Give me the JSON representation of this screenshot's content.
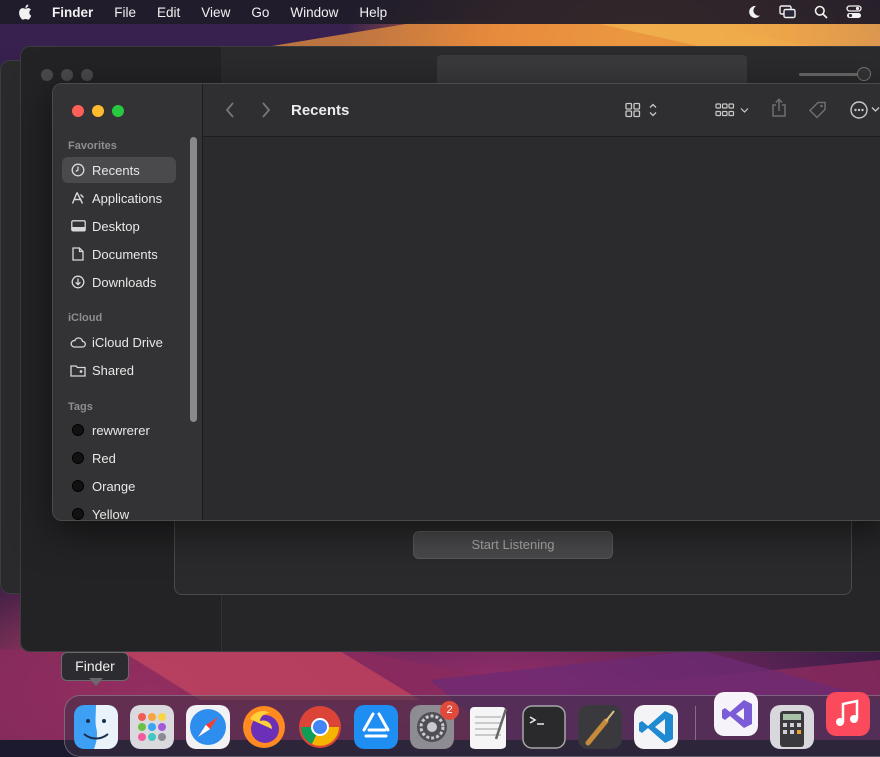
{
  "menubar": {
    "items": [
      "Finder",
      "File",
      "Edit",
      "View",
      "Go",
      "Window",
      "Help"
    ],
    "status_icons": [
      "moon-icon",
      "screen-mirroring-icon",
      "search-icon",
      "control-center-icon"
    ]
  },
  "finder": {
    "title": "Recents",
    "sidebar": {
      "favorites_header": "Favorites",
      "favorites": [
        {
          "label": "Recents",
          "icon": "clock-icon"
        },
        {
          "label": "Applications",
          "icon": "applications-icon"
        },
        {
          "label": "Desktop",
          "icon": "desktop-icon"
        },
        {
          "label": "Documents",
          "icon": "document-icon"
        },
        {
          "label": "Downloads",
          "icon": "download-icon"
        }
      ],
      "icloud_header": "iCloud",
      "icloud": [
        {
          "label": "iCloud Drive",
          "icon": "cloud-icon"
        },
        {
          "label": "Shared",
          "icon": "shared-folder-icon"
        }
      ],
      "tags_header": "Tags",
      "tags": [
        {
          "label": "rewwrerer"
        },
        {
          "label": "Red"
        },
        {
          "label": "Orange"
        },
        {
          "label": "Yellow"
        }
      ]
    }
  },
  "background_window": {
    "button_label": "Start Listening"
  },
  "dock": {
    "tooltip": "Finder",
    "badge": "2",
    "apps": [
      "Finder",
      "Launchpad",
      "Safari",
      "Firefox",
      "Chrome",
      "App Store",
      "System Settings",
      "TextEdit",
      "Terminal",
      "Instruments",
      "Visual Studio Code",
      "Visual Studio",
      "Calculator",
      "Music"
    ]
  },
  "colors": {
    "traffic_close": "#fe5f57",
    "traffic_minimize": "#febc2e",
    "traffic_zoom": "#28c840",
    "badge": "#e04a3b"
  }
}
